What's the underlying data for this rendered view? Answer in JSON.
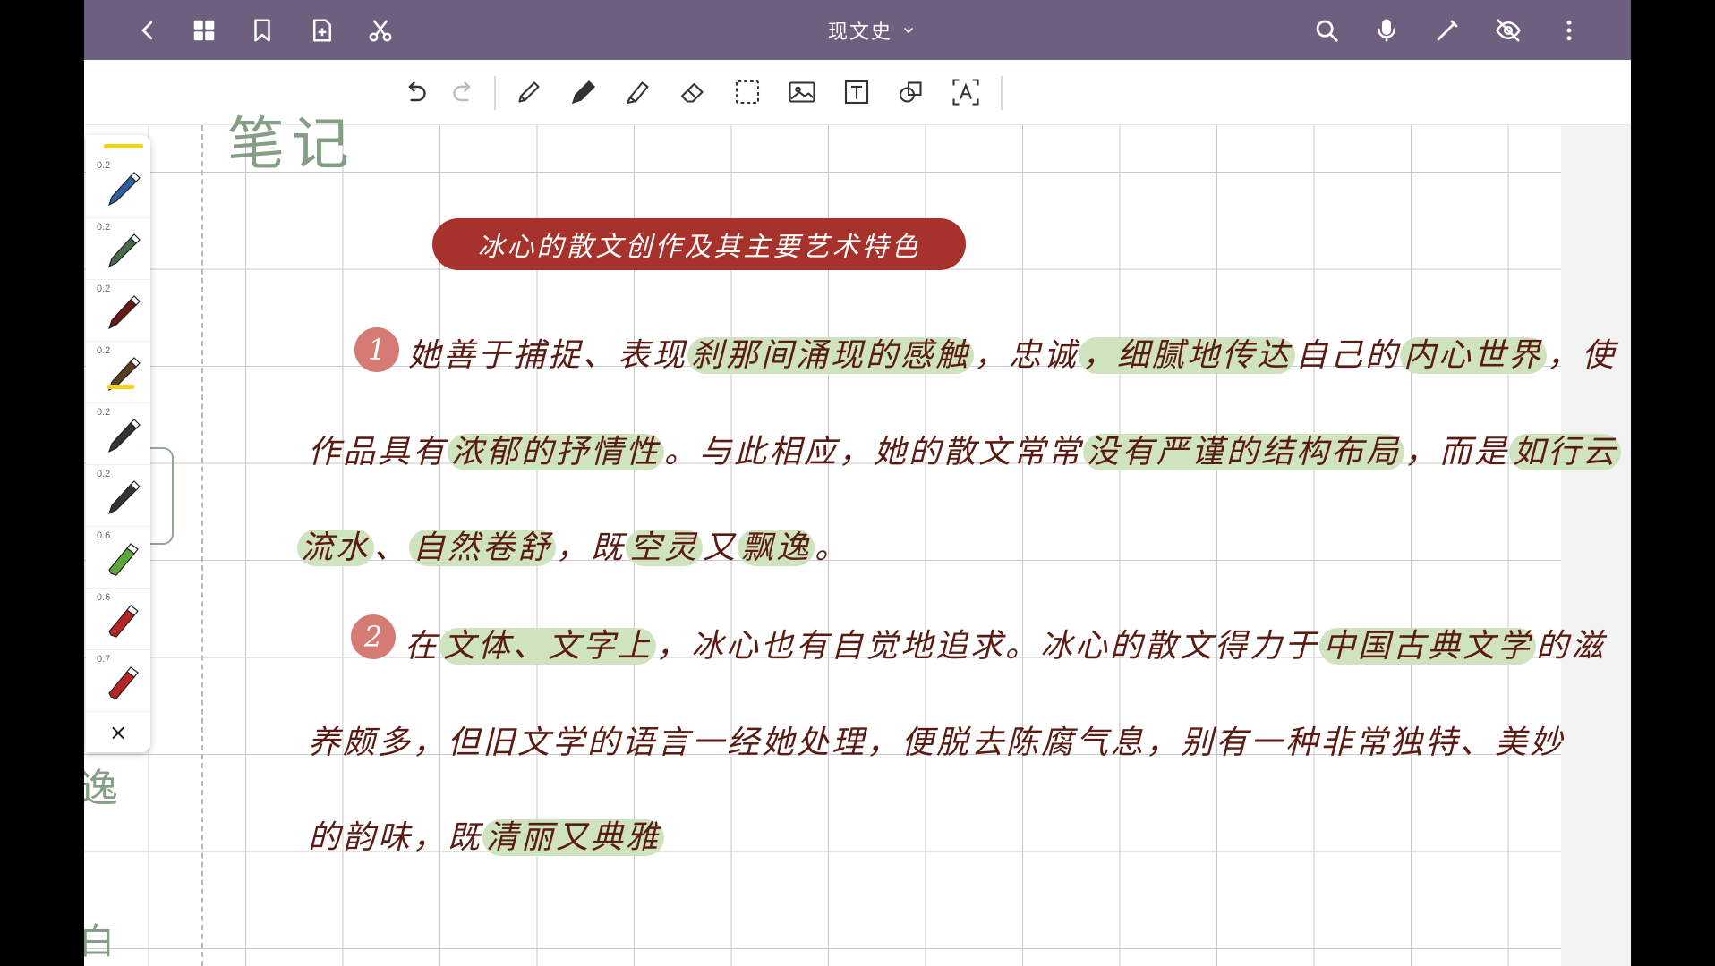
{
  "topbar": {
    "title": "现文史",
    "left_icons": [
      "back-icon",
      "grid-icon",
      "bookmark-icon",
      "add-page-icon",
      "scissors-icon"
    ],
    "right_icons": [
      "search-icon",
      "microphone-icon",
      "pencil-icon",
      "eye-off-icon",
      "more-vert-icon"
    ],
    "bg_color": "#6e5f7e"
  },
  "toolbar": {
    "tools": [
      "undo-icon",
      "redo-icon",
      "pencil-tool-icon",
      "fountain-pen-icon",
      "highlighter-icon",
      "eraser-icon",
      "lasso-select-icon",
      "image-icon",
      "text-box-icon",
      "shape-icon",
      "text-recognition-icon"
    ]
  },
  "palette": {
    "pens": [
      {
        "size": "0.2",
        "color": "#2f5fa0",
        "type": "pen"
      },
      {
        "size": "0.2",
        "color": "#4b6b4c",
        "type": "pen"
      },
      {
        "size": "0.2",
        "color": "#6a1a14",
        "type": "pen"
      },
      {
        "size": "0.2",
        "color": "#5a3d1e",
        "type": "pen",
        "active": true
      },
      {
        "size": "0.2",
        "color": "#333333",
        "type": "pen"
      },
      {
        "size": "0.2",
        "color": "#333333",
        "type": "pen"
      },
      {
        "size": "0.6",
        "color": "#5aa83a",
        "type": "marker"
      },
      {
        "size": "0.6",
        "color": "#b52525",
        "type": "marker"
      },
      {
        "size": "0.7",
        "color": "#b52525",
        "type": "marker"
      }
    ],
    "close": "×"
  },
  "note": {
    "ghost_title": "笔记",
    "ghost_side": [
      "逸",
      "白"
    ],
    "heading": "冰心的散文创作及其主要艺术特色",
    "numbers": [
      "1",
      "2"
    ],
    "para1": [
      [
        {
          "t": "她善于捕捉、表现",
          "h": false
        },
        {
          "t": "刹那间涌现的感触",
          "h": true
        },
        {
          "t": "，忠诚",
          "h": false
        },
        {
          "t": "，细腻地传达",
          "h": true
        },
        {
          "t": "自己的",
          "h": false
        },
        {
          "t": "内心世界",
          "h": true
        },
        {
          "t": "，使",
          "h": false
        }
      ],
      [
        {
          "t": "作品具有",
          "h": false
        },
        {
          "t": "浓郁的抒情性",
          "h": true
        },
        {
          "t": "。与此相应，她的散文常常",
          "h": false
        },
        {
          "t": "没有严谨的结构布局",
          "h": true
        },
        {
          "t": "，而是",
          "h": false
        },
        {
          "t": "如行云",
          "h": true
        }
      ],
      [
        {
          "t": "流水",
          "h": true
        },
        {
          "t": "、",
          "h": false
        },
        {
          "t": "自然卷舒",
          "h": true
        },
        {
          "t": "，既",
          "h": false
        },
        {
          "t": "空灵",
          "h": true
        },
        {
          "t": "又",
          "h": false
        },
        {
          "t": "飘逸",
          "h": true
        },
        {
          "t": "。",
          "h": false
        }
      ]
    ],
    "para2": [
      [
        {
          "t": "在",
          "h": false
        },
        {
          "t": "文体、文字上",
          "h": true
        },
        {
          "t": "，冰心也有自觉地追求。冰心的散文得力于",
          "h": false
        },
        {
          "t": "中国古典文学",
          "h": true
        },
        {
          "t": "的滋",
          "h": false
        }
      ],
      [
        {
          "t": "养颇多，但旧文学的语言一经她处理，便脱去陈腐气息，别有一种非常独特、美妙",
          "h": false
        }
      ],
      [
        {
          "t": "的韵味，既",
          "h": false
        },
        {
          "t": "清丽又典雅",
          "h": true
        }
      ]
    ]
  }
}
